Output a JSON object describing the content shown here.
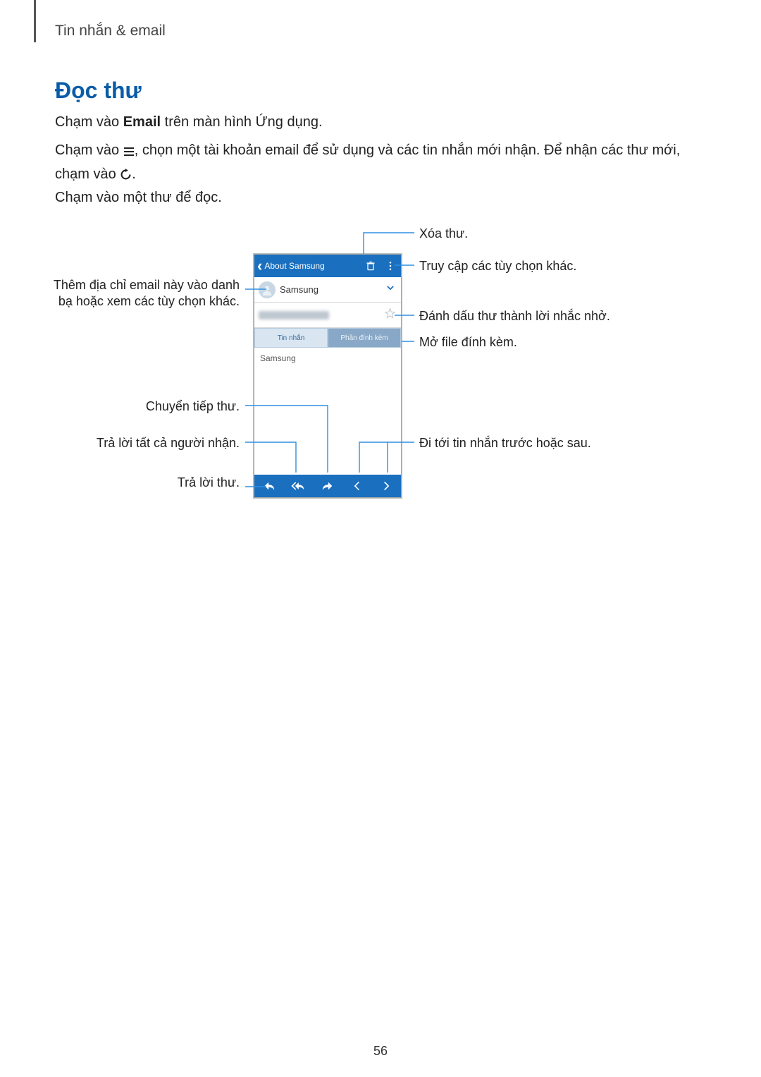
{
  "breadcrumb": "Tin nhắn & email",
  "section_title": "Đọc thư",
  "p1": {
    "pre": "Chạm vào ",
    "bold": "Email",
    "post": " trên màn hình Ứng dụng."
  },
  "p2": {
    "pre": "Chạm vào ",
    "mid": ", chọn một tài khoản email để sử dụng và các tin nhắn mới nhận. Để nhận các thư mới, chạm vào ",
    "post": "."
  },
  "p3": "Chạm vào một thư để đọc.",
  "phone": {
    "back_label": "About Samsung",
    "sender": "Samsung",
    "tab_message": "Tin nhắn",
    "tab_attachment": "Phần đính kèm",
    "body_text": "Samsung"
  },
  "callouts": {
    "delete": "Xóa thư.",
    "more": "Truy cập các tùy chọn khác.",
    "add_contact": "Thêm địa chỉ email này vào danh bạ hoặc xem các tùy chọn khác.",
    "favorite": "Đánh dấu thư thành lời nhắc nhở.",
    "attachment": "Mở file đính kèm.",
    "forward": "Chuyển tiếp thư.",
    "reply_all": "Trả lời tất cả người nhận.",
    "nav": "Đi tới tin nhắn trước hoặc sau.",
    "reply": "Trả lời thư."
  },
  "page_number": "56"
}
